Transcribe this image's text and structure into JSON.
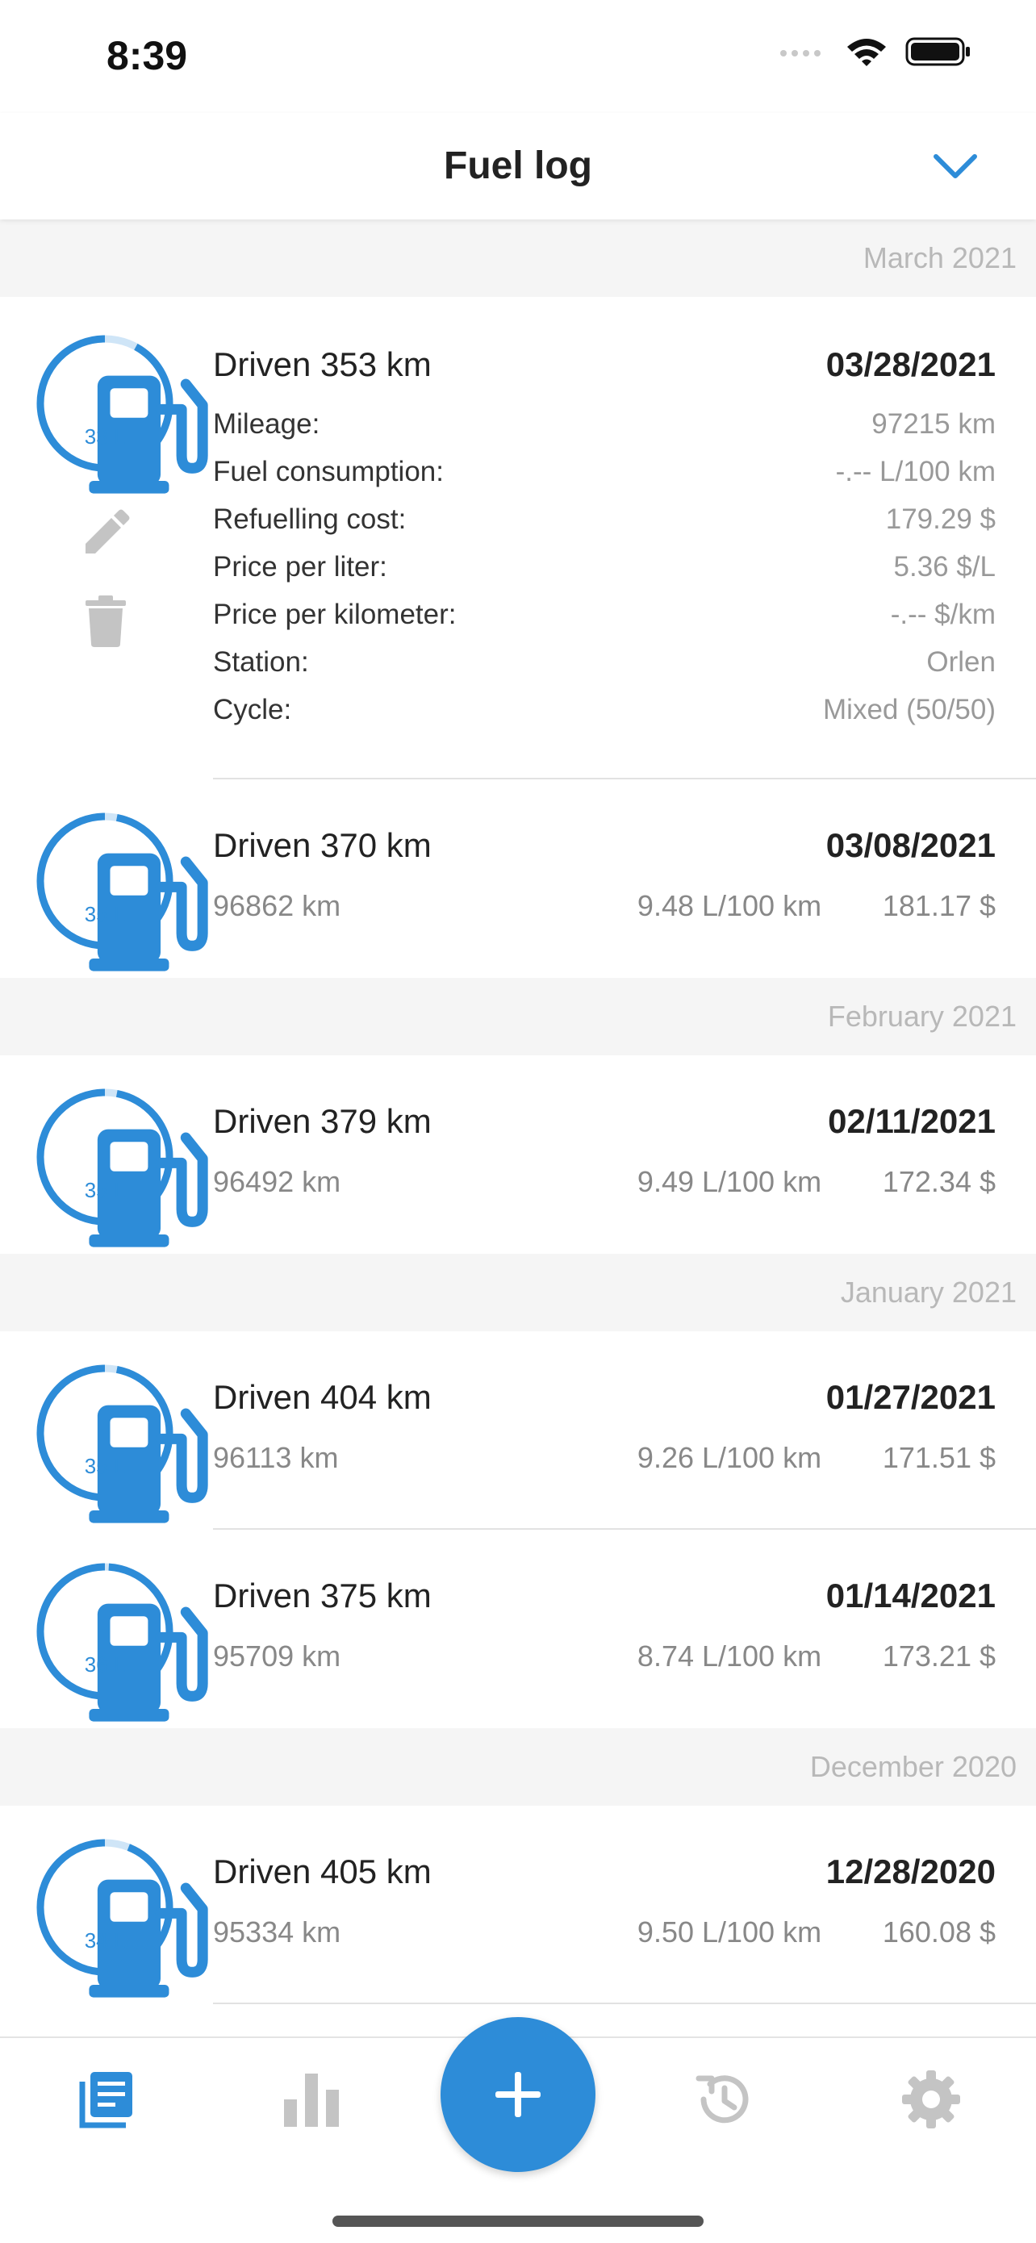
{
  "status": {
    "time": "8:39"
  },
  "header": {
    "title": "Fuel log"
  },
  "colors": {
    "accent": "#2d8cd8",
    "section_bg": "#f5f5f5",
    "muted": "#999999"
  },
  "sections": [
    {
      "month": "March 2021",
      "entries": [
        {
          "title": "Driven 353 km",
          "date": "03/28/2021",
          "fuel": "33 L",
          "fill": 0.92,
          "expanded": true,
          "details": [
            {
              "label": "Mileage:",
              "value": "97215 km"
            },
            {
              "label": "Fuel consumption:",
              "value": "-.-- L/100 km"
            },
            {
              "label": "Refuelling cost:",
              "value": "179.29 $"
            },
            {
              "label": "Price per liter:",
              "value": "5.36 $/L"
            },
            {
              "label": "Price per kilometer:",
              "value": "-.-- $/km"
            },
            {
              "label": "Station:",
              "value": "Orlen"
            },
            {
              "label": "Cycle:",
              "value": "Mixed (50/50)"
            }
          ]
        },
        {
          "title": "Driven 370 km",
          "date": "03/08/2021",
          "fuel": "35 L",
          "fill": 0.97,
          "mileage": "96862 km",
          "consumption": "9.48 L/100 km",
          "cost": "181.17 $"
        }
      ]
    },
    {
      "month": "February 2021",
      "entries": [
        {
          "title": "Driven 379 km",
          "date": "02/11/2021",
          "fuel": "35 L",
          "fill": 0.97,
          "mileage": "96492 km",
          "consumption": "9.49 L/100 km",
          "cost": "172.34 $"
        }
      ]
    },
    {
      "month": "January 2021",
      "entries": [
        {
          "title": "Driven 404 km",
          "date": "01/27/2021",
          "fuel": "35 L",
          "fill": 0.97,
          "mileage": "96113 km",
          "consumption": "9.26 L/100 km",
          "cost": "171.51 $"
        },
        {
          "title": "Driven 375 km",
          "date": "01/14/2021",
          "fuel": "36 L",
          "fill": 0.99,
          "mileage": "95709 km",
          "consumption": "8.74 L/100 km",
          "cost": "173.21 $"
        }
      ]
    },
    {
      "month": "December 2020",
      "entries": [
        {
          "title": "Driven 405 km",
          "date": "12/28/2020",
          "fuel": "34 L",
          "fill": 0.94,
          "mileage": "95334 km",
          "consumption": "9.50 L/100 km",
          "cost": "160.08 $"
        }
      ]
    }
  ],
  "tabs": [
    {
      "name": "log",
      "icon": "list-icon",
      "active": true
    },
    {
      "name": "stats",
      "icon": "bar-chart-icon",
      "active": false
    },
    {
      "name": "add",
      "icon": "plus-icon",
      "active": false
    },
    {
      "name": "reminders",
      "icon": "history-clock-icon",
      "active": false
    },
    {
      "name": "settings",
      "icon": "gear-icon",
      "active": false
    }
  ]
}
